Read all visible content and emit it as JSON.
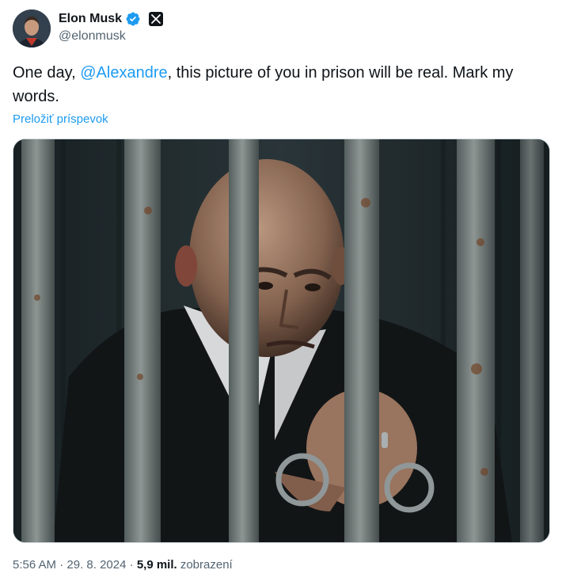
{
  "author": {
    "name": "Elon Musk",
    "handle": "@elonmusk",
    "verified_icon": "verified-badge-icon",
    "affiliate_icon": "x-logo-icon",
    "badge_color": "#1d9bf0"
  },
  "tweet": {
    "text_before": "One day, ",
    "mention": "@Alexandre",
    "text_after": ", this picture of you in prison will be real. Mark my words.",
    "translate_label": "Preložiť príspevok",
    "mention_color": "#1d9bf0"
  },
  "meta": {
    "time": "5:56 AM",
    "sep1": " · ",
    "date": "29. 8. 2024",
    "sep2": " · ",
    "views": "5,9 mil.",
    "views_label": " zobrazení"
  }
}
